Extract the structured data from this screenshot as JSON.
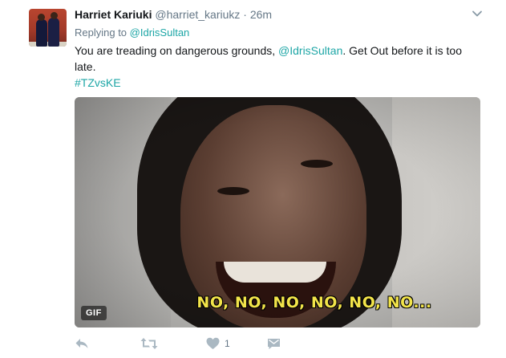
{
  "tweet": {
    "author_name": "Harriet Kariuki",
    "author_handle": "@harriet_kariukz",
    "separator": "·",
    "time": "26m",
    "replying_prefix": "Replying to ",
    "replying_to": "@IdrisSultan",
    "text_before": "You are treading on dangerous grounds, ",
    "text_mention": "@IdrisSultan",
    "text_after": ". Get Out before it is too late.",
    "hashtag": "#TZvsKE",
    "media": {
      "caption": "NO, NO, NO, NO, NO, NO...",
      "badge": "GIF"
    },
    "actions": {
      "like_count": "1"
    }
  },
  "colors": {
    "link": "#1da6a6",
    "muted": "#657786",
    "text": "#14171a",
    "caption": "#f2e44a"
  },
  "icons": {
    "reply": "reply-icon",
    "retweet": "retweet-icon",
    "like": "heart-icon",
    "dm": "direct-message-icon",
    "menu": "chevron-down-icon"
  }
}
